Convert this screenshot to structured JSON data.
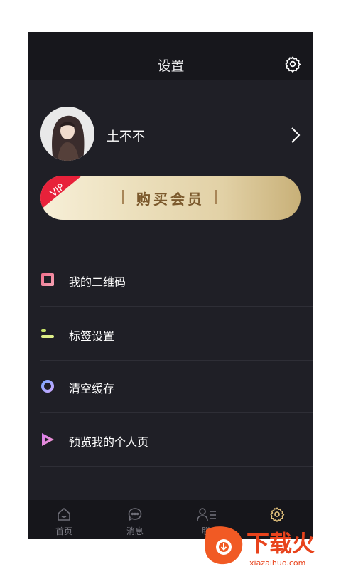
{
  "header": {
    "title": "设置",
    "settings_icon": "gear-icon"
  },
  "profile": {
    "name": "土不不"
  },
  "vip": {
    "badge": "VIP",
    "label": "购买会员",
    "colors": {
      "gold_start": "#f7efd8",
      "gold_end": "#c8b078",
      "badge_red": "#e8213a"
    }
  },
  "menu": [
    {
      "label": "我的二维码",
      "icon": "qrcode-square-icon"
    },
    {
      "label": "标签设置",
      "icon": "tag-settings-icon"
    },
    {
      "label": "清空缓存",
      "icon": "clear-cache-ring-icon"
    },
    {
      "label": "预览我的个人页",
      "icon": "preview-play-icon"
    }
  ],
  "tabbar": {
    "items": [
      {
        "label": "首页",
        "icon": "home-icon"
      },
      {
        "label": "消息",
        "icon": "message-icon"
      },
      {
        "label": "联",
        "icon": "contacts-icon"
      },
      {
        "label": "",
        "icon": "gear-icon"
      }
    ],
    "active_index": 3,
    "active_color": "#e3c27d"
  },
  "watermark": {
    "title": "下载火",
    "url": "xiazaihuo.com"
  }
}
